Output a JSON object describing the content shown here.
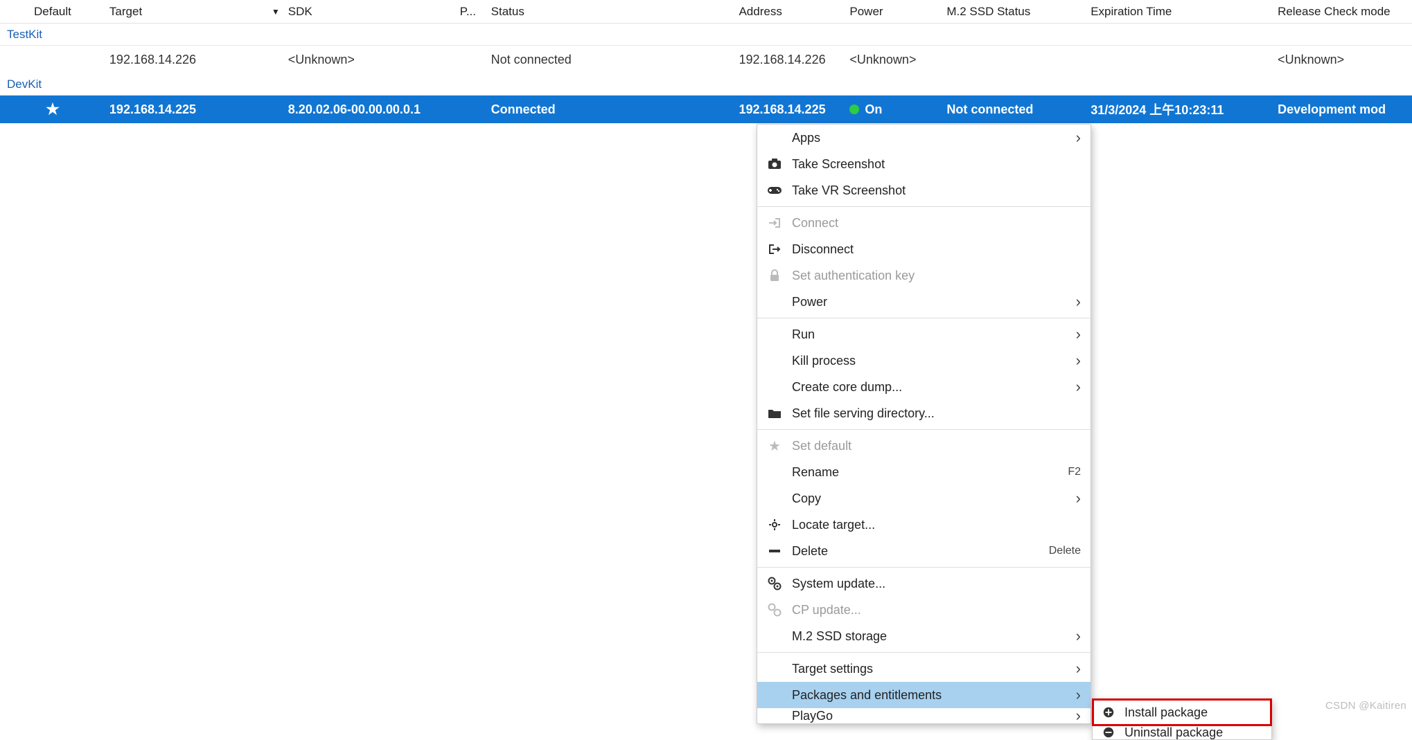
{
  "columns": {
    "default": "Default",
    "target": "Target",
    "sdk": "SDK",
    "p": "P...",
    "status": "Status",
    "address": "Address",
    "power": "Power",
    "m2": "M.2 SSD Status",
    "exp": "Expiration Time",
    "mode": "Release Check mode"
  },
  "groups": {
    "testkit": "TestKit",
    "devkit": "DevKit"
  },
  "rows": {
    "r1": {
      "default": "",
      "target": "192.168.14.226",
      "sdk": "<Unknown>",
      "p": "",
      "status": "Not connected",
      "address": "192.168.14.226",
      "power": "<Unknown>",
      "m2": "",
      "exp": "",
      "mode": "<Unknown>"
    },
    "r2": {
      "default_icon": "star",
      "target": "192.168.14.225",
      "sdk": "8.20.02.06-00.00.00.0.1",
      "p": "",
      "status": "Connected",
      "address": "192.168.14.225",
      "power": "On",
      "m2": "Not connected",
      "exp": "31/3/2024 上午10:23:11",
      "mode": "Development mod"
    }
  },
  "menu": [
    {
      "icon": "",
      "label": "Apps",
      "arrow": true
    },
    {
      "icon": "camera",
      "label": "Take Screenshot"
    },
    {
      "icon": "gamepad",
      "label": "Take VR Screenshot"
    },
    {
      "sep": true
    },
    {
      "icon": "login",
      "label": "Connect",
      "disabled": true
    },
    {
      "icon": "logout",
      "label": "Disconnect"
    },
    {
      "icon": "lock",
      "label": "Set authentication key",
      "disabled": true
    },
    {
      "icon": "",
      "label": "Power",
      "arrow": true
    },
    {
      "sep": true
    },
    {
      "icon": "",
      "label": "Run",
      "arrow": true
    },
    {
      "icon": "",
      "label": "Kill process",
      "arrow": true
    },
    {
      "icon": "",
      "label": "Create core dump...",
      "arrow": true
    },
    {
      "icon": "folder",
      "label": "Set file serving directory..."
    },
    {
      "sep": true
    },
    {
      "icon": "star",
      "label": "Set default",
      "disabled": true
    },
    {
      "icon": "",
      "label": "Rename",
      "shortcut": "F2"
    },
    {
      "icon": "",
      "label": "Copy",
      "arrow": true
    },
    {
      "icon": "locate",
      "label": "Locate target..."
    },
    {
      "icon": "minus",
      "label": "Delete",
      "shortcut": "Delete"
    },
    {
      "sep": true
    },
    {
      "icon": "gear",
      "label": "System update..."
    },
    {
      "icon": "gear2",
      "label": "CP update...",
      "disabled": true
    },
    {
      "icon": "",
      "label": "M.2 SSD storage",
      "arrow": true
    },
    {
      "sep": true
    },
    {
      "icon": "",
      "label": "Target settings",
      "arrow": true
    },
    {
      "icon": "",
      "label": "Packages and entitlements",
      "arrow": true,
      "highlight": true
    },
    {
      "icon": "",
      "label": "PlayGo",
      "arrow": true,
      "cut": true
    }
  ],
  "submenu": {
    "install": "Install package",
    "uninstall": "Uninstall package"
  },
  "watermark": "CSDN @Kaitiren"
}
